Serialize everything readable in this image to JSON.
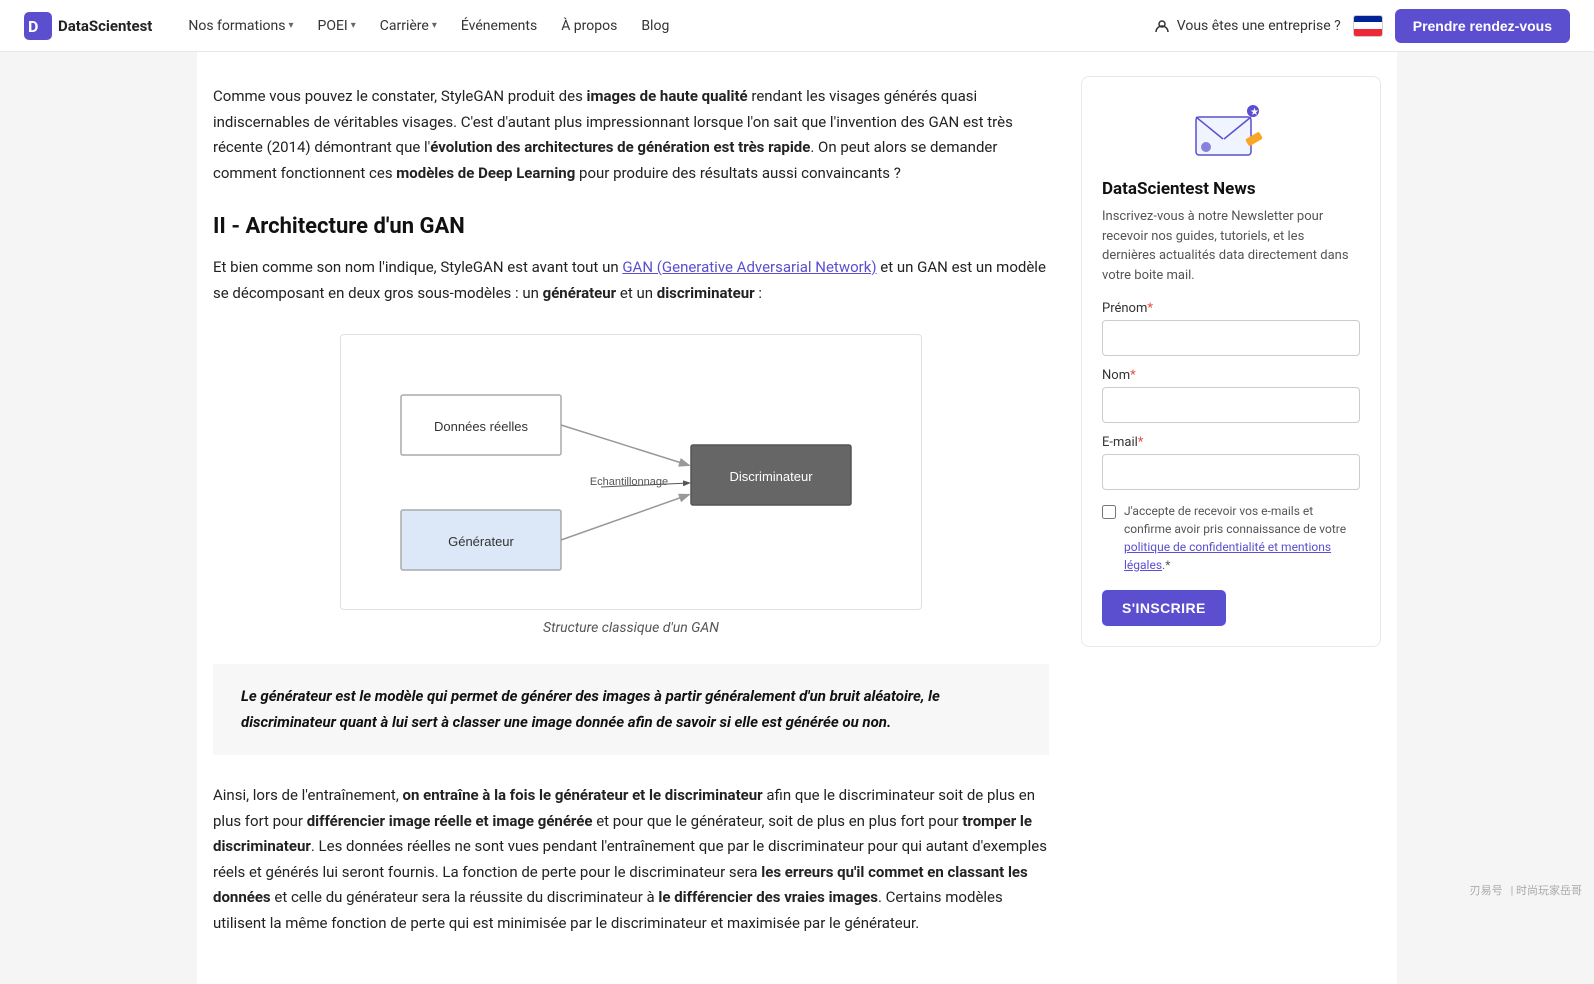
{
  "nav": {
    "logo_text": "DataScientest",
    "items": [
      {
        "label": "Nos formations",
        "has_dropdown": true
      },
      {
        "label": "POEI",
        "has_dropdown": true
      },
      {
        "label": "Carrière",
        "has_dropdown": true
      },
      {
        "label": "Événements",
        "has_dropdown": false
      },
      {
        "label": "À propos",
        "has_dropdown": false
      },
      {
        "label": "Blog",
        "has_dropdown": false
      }
    ],
    "enterprise_label": "Vous êtes une entreprise ?",
    "cta_label": "Prendre rendez-vous"
  },
  "main": {
    "intro_paragraph_html": "Comme vous pouvez le constater, StyleGAN produit des <b>images de haute qualité</b> rendant les visages générés quasi indiscernables de véritables visages. C'est d'autant plus impressionnant lorsque l'on sait que l'invention des GAN est très récente (2014) démontrant que l'<b>évolution des architectures de génération est très rapide</b>. On peut alors se demander comment fonctionnent ces <b>modèles de Deep Learning</b> pour produire des résultats aussi convaincants ?",
    "section_title": "II - Architecture d'un GAN",
    "section_intro_html": "Et bien comme son nom l'indique, StyleGAN est avant tout un <a href=\"#\" class=\"text-link\">GAN (Generative Adversarial Network)</a> et un GAN est un modèle se décomposant en deux gros sous-modèles : un <b>générateur</b> et un <b>discriminateur</b> :",
    "diagram": {
      "caption": "Structure classique d'un GAN",
      "node_donnees": "Données réelles",
      "node_generateur": "Générateur",
      "node_discriminateur": "Discriminateur",
      "edge_label": "Echantillonnage"
    },
    "callout": "Le générateur est le modèle qui permet de générer des images à partir généralement d'un bruit aléatoire, le discriminateur quant à lui sert à classer une image donnée afin de savoir si elle est générée ou non.",
    "bottom_paragraph_html": "Ainsi, lors de l'entraînement, <b>on entraîne à la fois le générateur et le discriminateur</b> afin que le discriminateur soit de plus en plus fort pour <b>différencier image réelle et image générée</b> et pour que le générateur, soit de plus en plus fort pour <b>tromper le discriminateur</b>. Les données réelles ne sont vues pendant l'entraînement que par le discriminateur pour qui autant d'exemples réels et générés lui seront fournis. La fonction de perte pour le discriminateur sera <b>les erreurs qu'il commet en classant les données</b> et celle du générateur sera la réussite du discriminateur à <b>le différencier des vraies images</b>. Certains modèles utilisent la même fonction de perte qui est minimisée par le discriminateur et maximisée par le générateur."
  },
  "sidebar": {
    "newsletter": {
      "title": "DataScientest News",
      "description": "Inscrivez-vous à notre Newsletter pour recevoir nos guides, tutoriels, et les dernières actualités data directement dans votre boite mail.",
      "prenom_label": "Prénom",
      "prenom_required": "*",
      "nom_label": "Nom",
      "nom_required": "*",
      "email_label": "E-mail",
      "email_required": "*",
      "checkbox_text": "J'accepte de recevoir vos e-mails et confirme avoir pris connaissance de votre politique de confidentialité et mentions légales.",
      "checkbox_required": "*",
      "submit_label": "S'INSCRIRE"
    }
  },
  "watermark": {
    "item1": "刃易号",
    "item2": "| 时尚玩家岳哥"
  }
}
